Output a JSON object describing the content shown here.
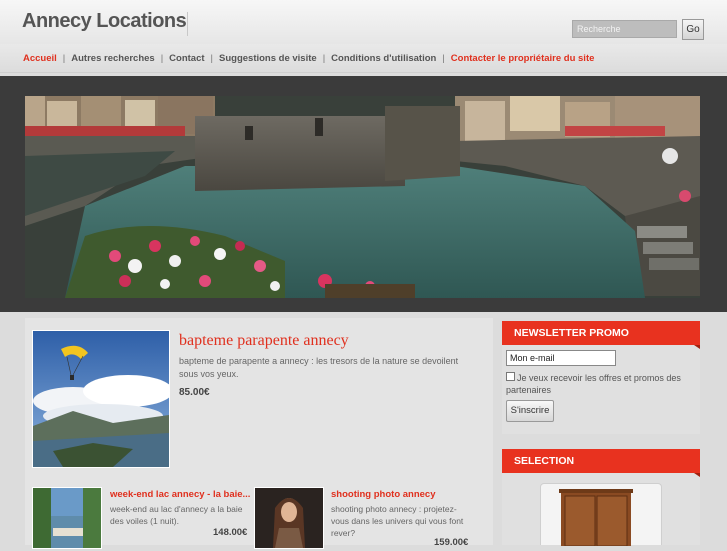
{
  "header": {
    "site_title": "Annecy Locations",
    "search_placeholder": "Recherche",
    "search_button": "Go"
  },
  "nav": {
    "items": [
      {
        "label": "Accueil",
        "active": true
      },
      {
        "label": "Autres recherches",
        "active": false
      },
      {
        "label": "Contact",
        "active": false
      },
      {
        "label": "Suggestions de visite",
        "active": false
      },
      {
        "label": "Conditions d'utilisation",
        "active": false
      },
      {
        "label": "Contacter le propriétaire du site",
        "active": true
      }
    ]
  },
  "featured": {
    "title": "bapteme parapente annecy",
    "description": "bapteme de parapente a annecy : les tresors de la nature se devoilent sous vos yeux.",
    "price": "85.00€"
  },
  "cards": [
    {
      "title": "week-end lac annecy - la baie...",
      "description": "week-end au lac d'annecy a la baie des voiles (1 nuit).",
      "price": "148.00€"
    },
    {
      "title": "shooting photo annecy",
      "description": "shooting photo annecy : projetez-vous dans les univers qui vous font rever?",
      "price": "159.00€"
    }
  ],
  "newsletter": {
    "header": "NEWSLETTER PROMO",
    "email_value": "Mon e-mail",
    "checkbox_label": "Je veux recevoir les offres et promos des partenaires",
    "button": "S'inscrire"
  },
  "selection": {
    "header": "SELECTION"
  },
  "colors": {
    "accent": "#e0301e",
    "text": "#555555",
    "band": "#3b3b3b"
  }
}
